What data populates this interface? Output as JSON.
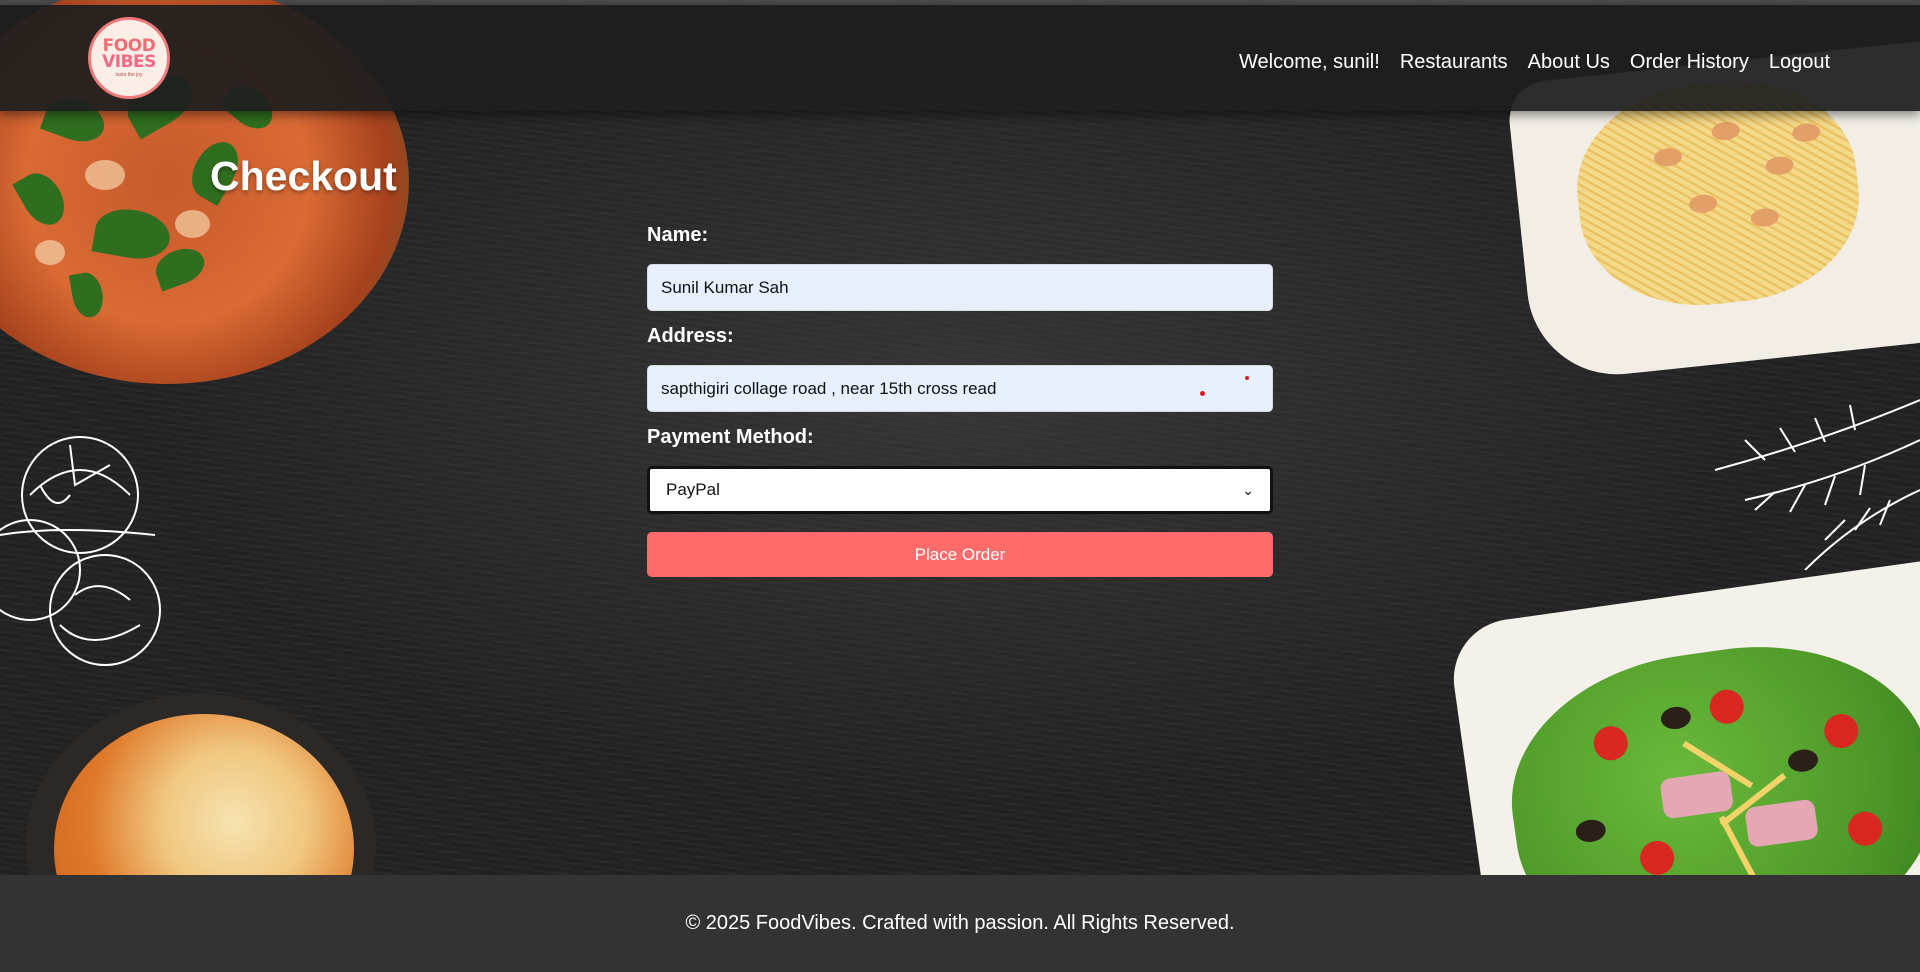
{
  "header": {
    "logo": {
      "line1": "FOOD",
      "line2": "VIBES",
      "tagline": "taste the joy"
    },
    "nav": {
      "welcome": "Welcome, sunil!",
      "restaurants": "Restaurants",
      "about": "About Us",
      "order_history": "Order History",
      "logout": "Logout"
    }
  },
  "page": {
    "title": "Checkout",
    "form": {
      "name_label": "Name:",
      "name_value": "Sunil Kumar Sah",
      "address_label": "Address:",
      "address_value": "sapthigiri collage road , near 15th cross read",
      "payment_label": "Payment Method:",
      "payment_selected": "PayPal",
      "submit_label": "Place Order"
    }
  },
  "footer": {
    "text": "© 2025 FoodVibes. Crafted with passion. All Rights Reserved."
  },
  "colors": {
    "accent": "#ff6b6b",
    "header_bg": "#1e1e1e",
    "footer_bg": "#333333",
    "input_bg": "#e8f0fe"
  }
}
